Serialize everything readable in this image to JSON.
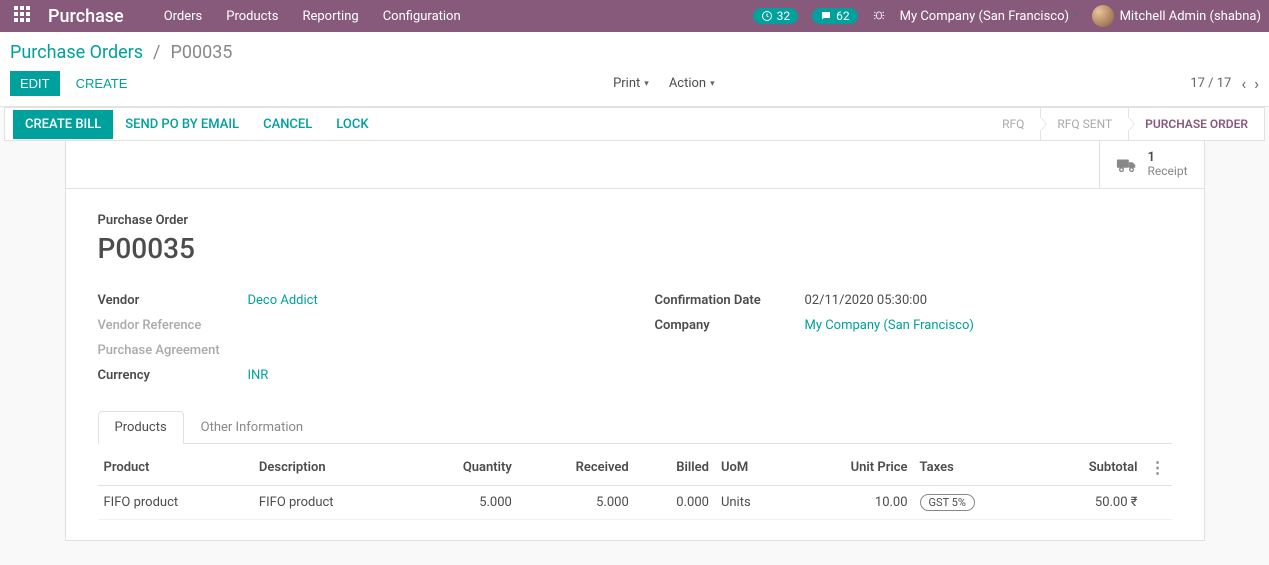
{
  "topnav": {
    "brand": "Purchase",
    "menu": [
      "Orders",
      "Products",
      "Reporting",
      "Configuration"
    ],
    "activity_count": "32",
    "message_count": "62",
    "company": "My Company (San Francisco)",
    "user": "Mitchell Admin (shabna)"
  },
  "breadcrumb": {
    "parent": "Purchase Orders",
    "current": "P00035"
  },
  "buttons": {
    "edit": "EDIT",
    "create": "CREATE",
    "print": "Print",
    "action": "Action",
    "create_bill": "CREATE BILL",
    "send_po": "SEND PO BY EMAIL",
    "cancel": "CANCEL",
    "lock": "LOCK"
  },
  "pager": {
    "text": "17 / 17"
  },
  "stages": {
    "rfq": "RFQ",
    "rfq_sent": "RFQ SENT",
    "purchase_order": "PURCHASE ORDER"
  },
  "stat": {
    "count": "1",
    "label": "Receipt"
  },
  "form": {
    "title_label": "Purchase Order",
    "number": "P00035",
    "labels": {
      "vendor": "Vendor",
      "vendor_ref": "Vendor Reference",
      "purchase_agreement": "Purchase Agreement",
      "currency": "Currency",
      "confirm_date": "Confirmation Date",
      "company": "Company"
    },
    "values": {
      "vendor": "Deco Addict",
      "currency": "INR",
      "confirm_date": "02/11/2020 05:30:00",
      "company": "My Company (San Francisco)"
    }
  },
  "tabs": {
    "products": "Products",
    "other": "Other Information"
  },
  "table": {
    "headers": {
      "product": "Product",
      "description": "Description",
      "quantity": "Quantity",
      "received": "Received",
      "billed": "Billed",
      "uom": "UoM",
      "unit_price": "Unit Price",
      "taxes": "Taxes",
      "subtotal": "Subtotal"
    },
    "rows": [
      {
        "product": "FIFO product",
        "description": "FIFO product",
        "quantity": "5.000",
        "received": "5.000",
        "billed": "0.000",
        "uom": "Units",
        "unit_price": "10.00",
        "taxes": "GST 5%",
        "subtotal": "50.00 ₹"
      }
    ]
  }
}
